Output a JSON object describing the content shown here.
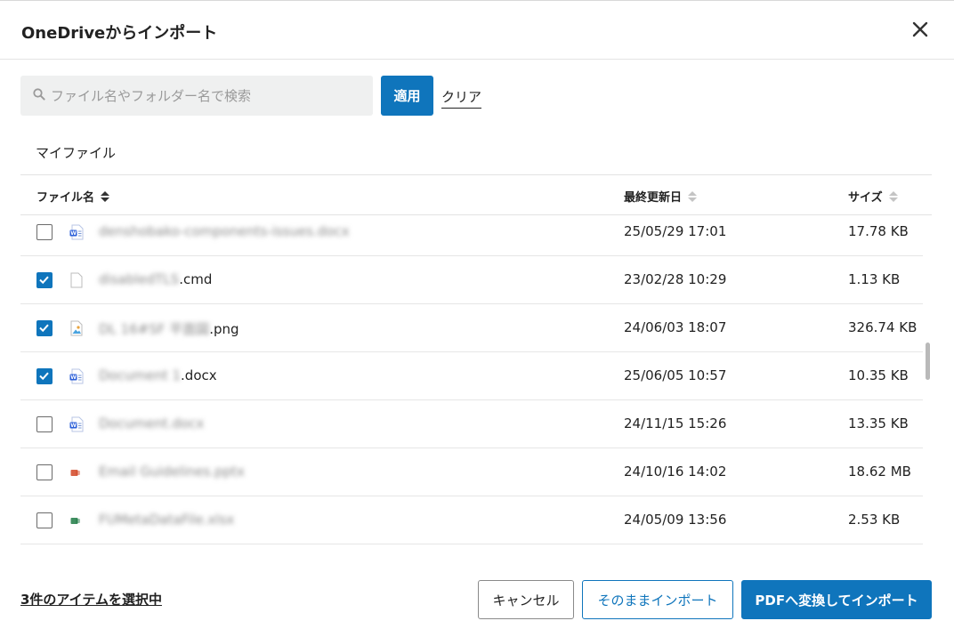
{
  "dialog": {
    "title": "OneDriveからインポート"
  },
  "search": {
    "placeholder": "ファイル名やフォルダー名で検索",
    "value": ""
  },
  "buttons": {
    "apply": "適用",
    "clear": "クリア",
    "cancel": "キャンセル",
    "import_as_is": "そのままインポート",
    "import_pdf": "PDFへ変換してインポート"
  },
  "breadcrumb": "マイファイル",
  "columns": {
    "name": "ファイル名",
    "modified": "最終更新日",
    "size": "サイズ"
  },
  "files": [
    {
      "name_blurred": "denshobako-components-issues.docx",
      "name_visible": "",
      "modified": "25/05/29 17:01",
      "size": "17.78 KB",
      "checked": false,
      "type": "word-file-icon",
      "color": "#2b5fd9"
    },
    {
      "name_blurred": "disabledTLS",
      "name_visible": ".cmd",
      "modified": "23/02/28 10:29",
      "size": "1.13 KB",
      "checked": true,
      "type": "generic-file-icon",
      "color": "#bdbdbd"
    },
    {
      "name_blurred": "DL 16#SF 平面図",
      "name_visible": ".png",
      "modified": "24/06/03 18:07",
      "size": "326.74 KB",
      "checked": true,
      "type": "image-file-icon",
      "color": "#bdbdbd"
    },
    {
      "name_blurred": "Document 1",
      "name_visible": ".docx",
      "modified": "25/06/05 10:57",
      "size": "10.35 KB",
      "checked": true,
      "type": "word-file-icon",
      "color": "#2b5fd9"
    },
    {
      "name_blurred": "Document.docx",
      "name_visible": "",
      "modified": "24/11/15 15:26",
      "size": "13.35 KB",
      "checked": false,
      "type": "word-file-icon",
      "color": "#2b5fd9"
    },
    {
      "name_blurred": "Email Guidelines.pptx",
      "name_visible": "",
      "modified": "24/10/16 14:02",
      "size": "18.62 MB",
      "checked": false,
      "type": "powerpoint-file-icon",
      "color": "#d24726"
    },
    {
      "name_blurred": "FUMetaDataFile.xlsx",
      "name_visible": "",
      "modified": "24/05/09 13:56",
      "size": "2.53 KB",
      "checked": false,
      "type": "excel-file-icon",
      "color": "#1e7b45"
    }
  ],
  "selection": {
    "summary": "3件のアイテムを選択中"
  },
  "colors": {
    "accent": "#0f75bc"
  }
}
